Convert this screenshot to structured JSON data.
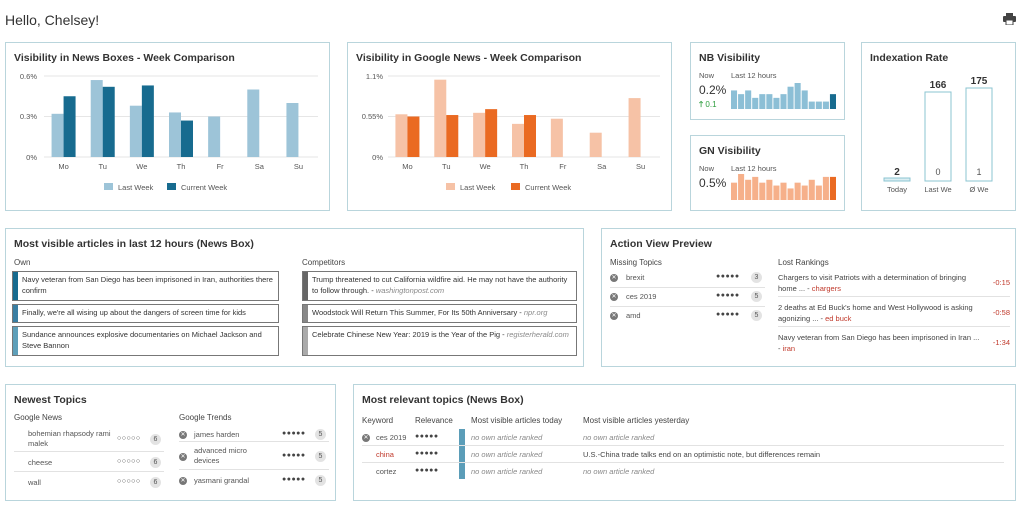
{
  "header": {
    "greeting": "Hello, Chelsey!",
    "print_icon": "print-icon"
  },
  "nb_week": {
    "title": "Visibility in News Boxes - Week Comparison",
    "yticks": [
      "0.6%",
      "0.3%",
      "0%"
    ],
    "legend_last": "Last Week",
    "legend_current": "Current Week",
    "colors": {
      "last": "#9dc4d8",
      "current": "#176b8f"
    }
  },
  "gn_week": {
    "title": "Visibility in Google News - Week Comparison",
    "yticks": [
      "1.1%",
      "0.55%",
      "0%"
    ],
    "legend_last": "Last Week",
    "legend_current": "Current Week",
    "colors": {
      "last": "#f6c2a6",
      "current": "#ea6a22"
    }
  },
  "chart_data": [
    {
      "type": "bar",
      "title": "Visibility in News Boxes - Week Comparison",
      "categories": [
        "Mo",
        "Tu",
        "We",
        "Th",
        "Fr",
        "Sa",
        "Su"
      ],
      "ylim": [
        0,
        0.6
      ],
      "series": [
        {
          "name": "Last Week",
          "values": [
            0.32,
            0.57,
            0.38,
            0.33,
            0.3,
            0.5,
            0.4
          ]
        },
        {
          "name": "Current Week",
          "values": [
            0.45,
            0.52,
            0.53,
            0.27,
            null,
            null,
            null
          ]
        }
      ]
    },
    {
      "type": "bar",
      "title": "Visibility in Google News - Week Comparison",
      "categories": [
        "Mo",
        "Tu",
        "We",
        "Th",
        "Fr",
        "Sa",
        "Su"
      ],
      "ylim": [
        0,
        1.1
      ],
      "series": [
        {
          "name": "Last Week",
          "values": [
            0.58,
            1.05,
            0.6,
            0.45,
            0.52,
            0.33,
            0.8
          ]
        },
        {
          "name": "Current Week",
          "values": [
            0.55,
            0.57,
            0.65,
            0.57,
            null,
            null,
            null
          ]
        }
      ]
    },
    {
      "type": "bar",
      "title": "NB Visibility",
      "values": [
        5,
        4,
        5,
        3,
        4,
        4,
        3,
        4,
        6,
        7,
        5,
        2,
        2,
        2,
        4
      ]
    },
    {
      "type": "bar",
      "title": "GN Visibility",
      "values": [
        6,
        9,
        7,
        8,
        6,
        7,
        5,
        6,
        4,
        6,
        5,
        7,
        5,
        8,
        8
      ]
    },
    {
      "type": "bar",
      "title": "Indexation Rate",
      "categories": [
        "Today",
        "Last We",
        "Ø We"
      ],
      "values": [
        2,
        166,
        175
      ],
      "inner_values": [
        "",
        "0",
        "1"
      ]
    }
  ],
  "nb_vis": {
    "title": "NB Visibility",
    "now_label": "Now",
    "last_label": "Last 12 hours",
    "value": "0.2%",
    "delta": "0.1"
  },
  "gn_vis": {
    "title": "GN Visibility",
    "now_label": "Now",
    "last_label": "Last 12 hours",
    "value": "0.5%"
  },
  "index": {
    "title": "Indexation Rate",
    "values": [
      "2",
      "166",
      "175"
    ],
    "inner": [
      "0",
      "1"
    ],
    "labels": [
      "Today",
      "Last We",
      "Ø We"
    ]
  },
  "articles": {
    "title": "Most visible articles in last 12 hours (News Box)",
    "own_label": "Own",
    "comp_label": "Competitors",
    "own": [
      {
        "text": "Navy veteran from San Diego has been imprisoned in Iran, authorities there confirm"
      },
      {
        "text": "Finally, we're all wising up about the dangers of screen time for kids"
      },
      {
        "text": "Sundance announces explosive documentaries on Michael Jackson and Steve Bannon"
      }
    ],
    "comp": [
      {
        "text": "Trump threatened to cut California wildfire aid. He may not have the authority to follow through. -",
        "src": "washingtonpost.com"
      },
      {
        "text": "Woodstock Will Return This Summer, For Its 50th Anniversary -",
        "src": "npr.org"
      },
      {
        "text": "Celebrate Chinese New Year: 2019 is the Year of the Pig -",
        "src": "registerherald.com"
      }
    ]
  },
  "action": {
    "title": "Action View Preview",
    "missing_label": "Missing Topics",
    "lost_label": "Lost Rankings",
    "missing": [
      {
        "name": "brexit",
        "dots": "●●●●●",
        "count": "3"
      },
      {
        "name": "ces 2019",
        "dots": "●●●●●",
        "count": "5"
      },
      {
        "name": "amd",
        "dots": "●●●●●",
        "count": "5"
      }
    ],
    "lost": [
      {
        "text": "Chargers to visit Patriots with a determination of bringing home ... -",
        "tag": "chargers",
        "val": "-0:15"
      },
      {
        "text": "2 deaths at Ed Buck's home and West Hollywood is asking agonizing ... -",
        "tag": "ed buck",
        "val": "-0:58"
      },
      {
        "text": "Navy veteran from San Diego has been imprisoned in Iran ... -",
        "tag": "iran",
        "val": "-1:34"
      }
    ]
  },
  "newest": {
    "title": "Newest Topics",
    "gn_label": "Google News",
    "gt_label": "Google Trends",
    "gn": [
      {
        "name": "bohemian rhapsody rami malek",
        "dots": "○○○○○",
        "count": "6"
      },
      {
        "name": "cheese",
        "dots": "○○○○○",
        "count": "6"
      },
      {
        "name": "wall",
        "dots": "○○○○○",
        "count": "6"
      }
    ],
    "gt": [
      {
        "name": "james harden",
        "dots": "●●●●●",
        "count": "5"
      },
      {
        "name": "advanced micro devices",
        "dots": "●●●●●",
        "count": "5"
      },
      {
        "name": "yasmani grandal",
        "dots": "●●●●●",
        "count": "5"
      }
    ]
  },
  "relevant": {
    "title": "Most relevant topics (News Box)",
    "headers": [
      "Keyword",
      "Relevance",
      "Most visible articles today",
      "Most visible articles yesterday"
    ],
    "rows": [
      {
        "kw": "ces 2019",
        "rel": "●●●●●",
        "today": "no own article ranked",
        "yest": "no own article ranked"
      },
      {
        "kw": "china",
        "rel": "●●●●●",
        "today": "no own article ranked",
        "yest": "U.S.-China trade talks end on an optimistic note, but differences remain"
      },
      {
        "kw": "cortez",
        "rel": "●●●●●",
        "today": "no own article ranked",
        "yest": "no own article ranked"
      }
    ]
  }
}
